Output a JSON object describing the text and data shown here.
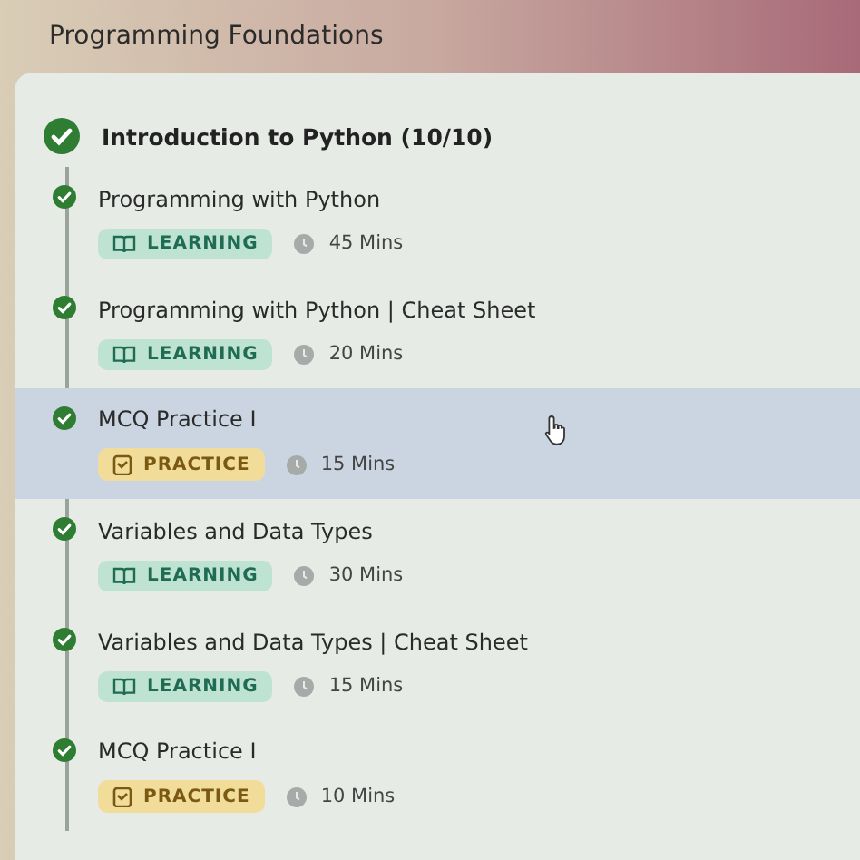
{
  "title": "Programming Foundations",
  "module": {
    "title": "Introduction to Python (10/10)",
    "completed": true
  },
  "items": [
    {
      "title": "Programming with Python",
      "kind": "learning",
      "tag": "LEARNING",
      "duration": "45 Mins",
      "completed": true,
      "hovered": false
    },
    {
      "title": "Programming with Python | Cheat Sheet",
      "kind": "learning",
      "tag": "LEARNING",
      "duration": "20 Mins",
      "completed": true,
      "hovered": false
    },
    {
      "title": "MCQ Practice I",
      "kind": "practice",
      "tag": "PRACTICE",
      "duration": "15 Mins",
      "completed": true,
      "hovered": true
    },
    {
      "title": "Variables and Data Types",
      "kind": "learning",
      "tag": "LEARNING",
      "duration": "30 Mins",
      "completed": true,
      "hovered": false
    },
    {
      "title": "Variables and Data Types | Cheat Sheet",
      "kind": "learning",
      "tag": "LEARNING",
      "duration": "15 Mins",
      "completed": true,
      "hovered": false
    },
    {
      "title": "MCQ Practice I",
      "kind": "practice",
      "tag": "PRACTICE",
      "duration": "10 Mins",
      "completed": true,
      "hovered": false
    }
  ]
}
